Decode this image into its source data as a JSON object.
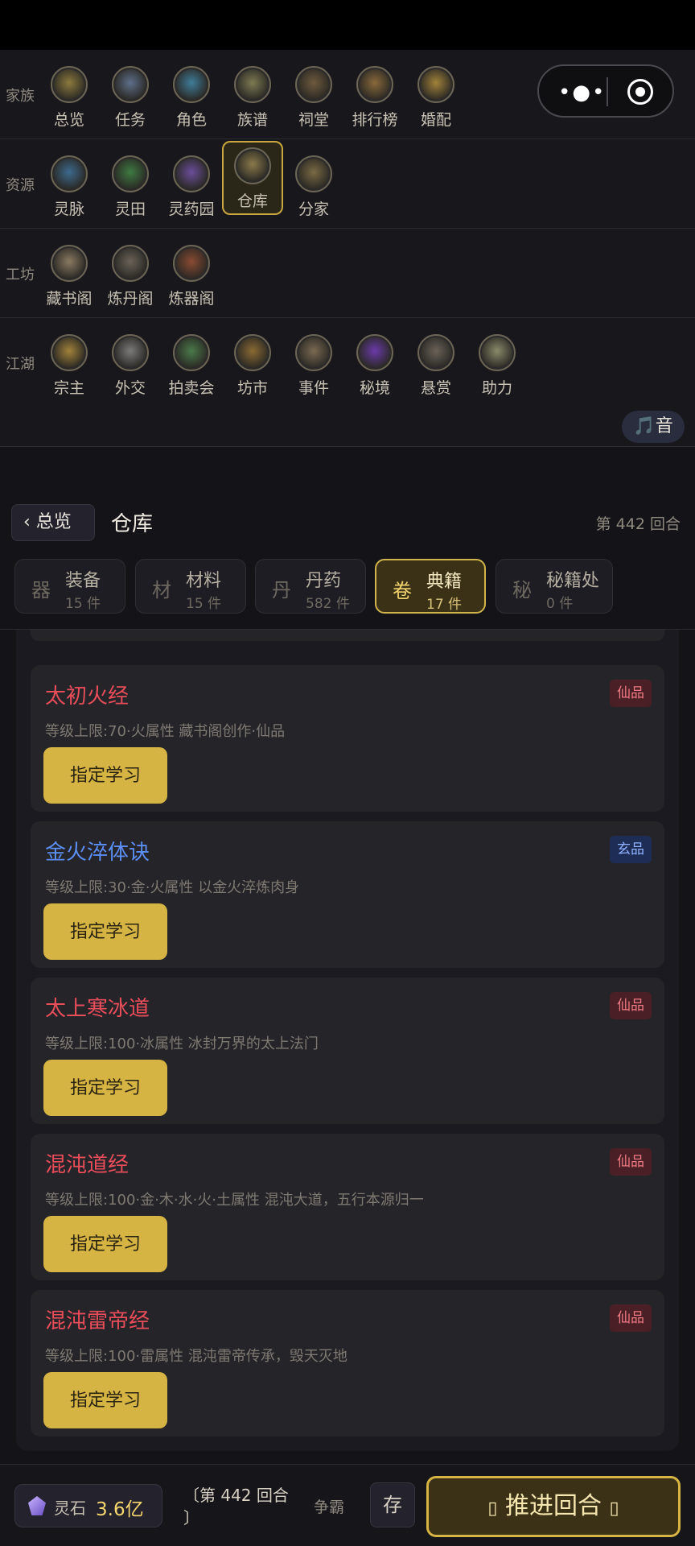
{
  "nav": {
    "groups": [
      {
        "label": "家族",
        "items": [
          {
            "label": "总览",
            "icon": "overview-icon",
            "color": "#8c7a3e"
          },
          {
            "label": "任务",
            "icon": "task-icon",
            "color": "#5e6f8a"
          },
          {
            "label": "角色",
            "icon": "character-icon",
            "color": "#3f7d9a"
          },
          {
            "label": "族谱",
            "icon": "family-tree-icon",
            "color": "#7d7a52"
          },
          {
            "label": "祠堂",
            "icon": "shrine-icon",
            "color": "#6e5a3d"
          },
          {
            "label": "排行榜",
            "icon": "ranking-icon",
            "color": "#8a6a3a"
          },
          {
            "label": "婚配",
            "icon": "marriage-icon",
            "color": "#a2823a"
          }
        ]
      },
      {
        "label": "资源",
        "items": [
          {
            "label": "灵脉",
            "icon": "spirit-vein-icon",
            "color": "#3d6a8e"
          },
          {
            "label": "灵田",
            "icon": "spirit-field-icon",
            "color": "#3e7a42"
          },
          {
            "label": "灵药园",
            "icon": "herb-garden-icon",
            "color": "#6a4e9a"
          },
          {
            "label": "仓库",
            "icon": "warehouse-icon",
            "color": "#8a7a4a"
          },
          {
            "label": "分家",
            "icon": "branch-family-icon",
            "color": "#7a6a44"
          }
        ]
      },
      {
        "label": "工坊",
        "items": [
          {
            "label": "藏书阁",
            "icon": "library-icon",
            "color": "#8a7a62"
          },
          {
            "label": "炼丹阁",
            "icon": "alchemy-icon",
            "color": "#6a6258"
          },
          {
            "label": "炼器阁",
            "icon": "forge-icon",
            "color": "#8a4a32"
          }
        ]
      },
      {
        "label": "江湖",
        "items": [
          {
            "label": "宗主",
            "icon": "sect-master-icon",
            "color": "#a2823a"
          },
          {
            "label": "外交",
            "icon": "diplomacy-icon",
            "color": "#7a7a7a"
          },
          {
            "label": "拍卖会",
            "icon": "auction-icon",
            "color": "#4a7a4a"
          },
          {
            "label": "坊市",
            "icon": "market-icon",
            "color": "#8a6a32"
          },
          {
            "label": "事件",
            "icon": "event-icon",
            "color": "#7a6a52"
          },
          {
            "label": "秘境",
            "icon": "secret-realm-icon",
            "color": "#6a3aaa"
          },
          {
            "label": "悬赏",
            "icon": "bounty-icon",
            "color": "#6a6258"
          },
          {
            "label": "助力",
            "icon": "assist-icon",
            "color": "#8a8a6a"
          }
        ]
      }
    ],
    "active_item": "仓库"
  },
  "capsule": {
    "more_icon": "more-dots-icon",
    "close_icon": "target-circle-icon"
  },
  "music_button": {
    "label": "🎵音"
  },
  "warehouse": {
    "back_label": "‹ 总览",
    "title": "仓库",
    "round": "第 442 回合"
  },
  "tabs": [
    {
      "glyph": "器",
      "name": "装备",
      "count": "15 件",
      "active": false
    },
    {
      "glyph": "材",
      "name": "材料",
      "count": "15 件",
      "active": false
    },
    {
      "glyph": "丹",
      "name": "丹药",
      "count": "582 件",
      "active": false
    },
    {
      "glyph": "卷",
      "name": "典籍",
      "count": "17 件",
      "active": true
    },
    {
      "glyph": "秘",
      "name": "秘籍处",
      "count": "0 件",
      "active": false
    }
  ],
  "books": [
    {
      "name": "太初火经",
      "grade": "仙品",
      "tier": "red",
      "desc": "等级上限:70·火属性  藏书阁创作·仙品",
      "action": "指定学习"
    },
    {
      "name": "金火淬体诀",
      "grade": "玄品",
      "tier": "blue",
      "desc": "等级上限:30·金·火属性  以金火淬炼肉身",
      "action": "指定学习"
    },
    {
      "name": "太上寒冰道",
      "grade": "仙品",
      "tier": "red",
      "desc": "等级上限:100·冰属性  冰封万界的太上法门",
      "action": "指定学习"
    },
    {
      "name": "混沌道经",
      "grade": "仙品",
      "tier": "red",
      "desc": "等级上限:100·金·木·水·火·土属性  混沌大道，五行本源归一",
      "action": "指定学习"
    },
    {
      "name": "混沌雷帝经",
      "grade": "仙品",
      "tier": "red",
      "desc": "等级上限:100·雷属性  混沌雷帝传承，毁天灭地",
      "action": "指定学习"
    }
  ],
  "bottom": {
    "stone_label": "灵石",
    "stone_value": "3.6亿",
    "round_text": "〔第 442 回合 〕",
    "contest": "争霸",
    "save": "存",
    "advance": "推进回合",
    "advance_left_glyph": "▯",
    "advance_right_glyph": "▯"
  }
}
